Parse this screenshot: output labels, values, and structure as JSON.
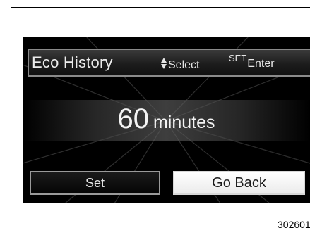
{
  "header": {
    "title": "Eco History",
    "select_hint": "Select",
    "enter_prefix": "SET",
    "enter_hint": "Enter",
    "select_icon": "up-down-arrows-icon"
  },
  "display": {
    "value": "60",
    "unit": "minutes"
  },
  "buttons": {
    "set_label": "Set",
    "go_back_label": "Go Back",
    "selected": "Go Back"
  },
  "figure_code": "302601"
}
